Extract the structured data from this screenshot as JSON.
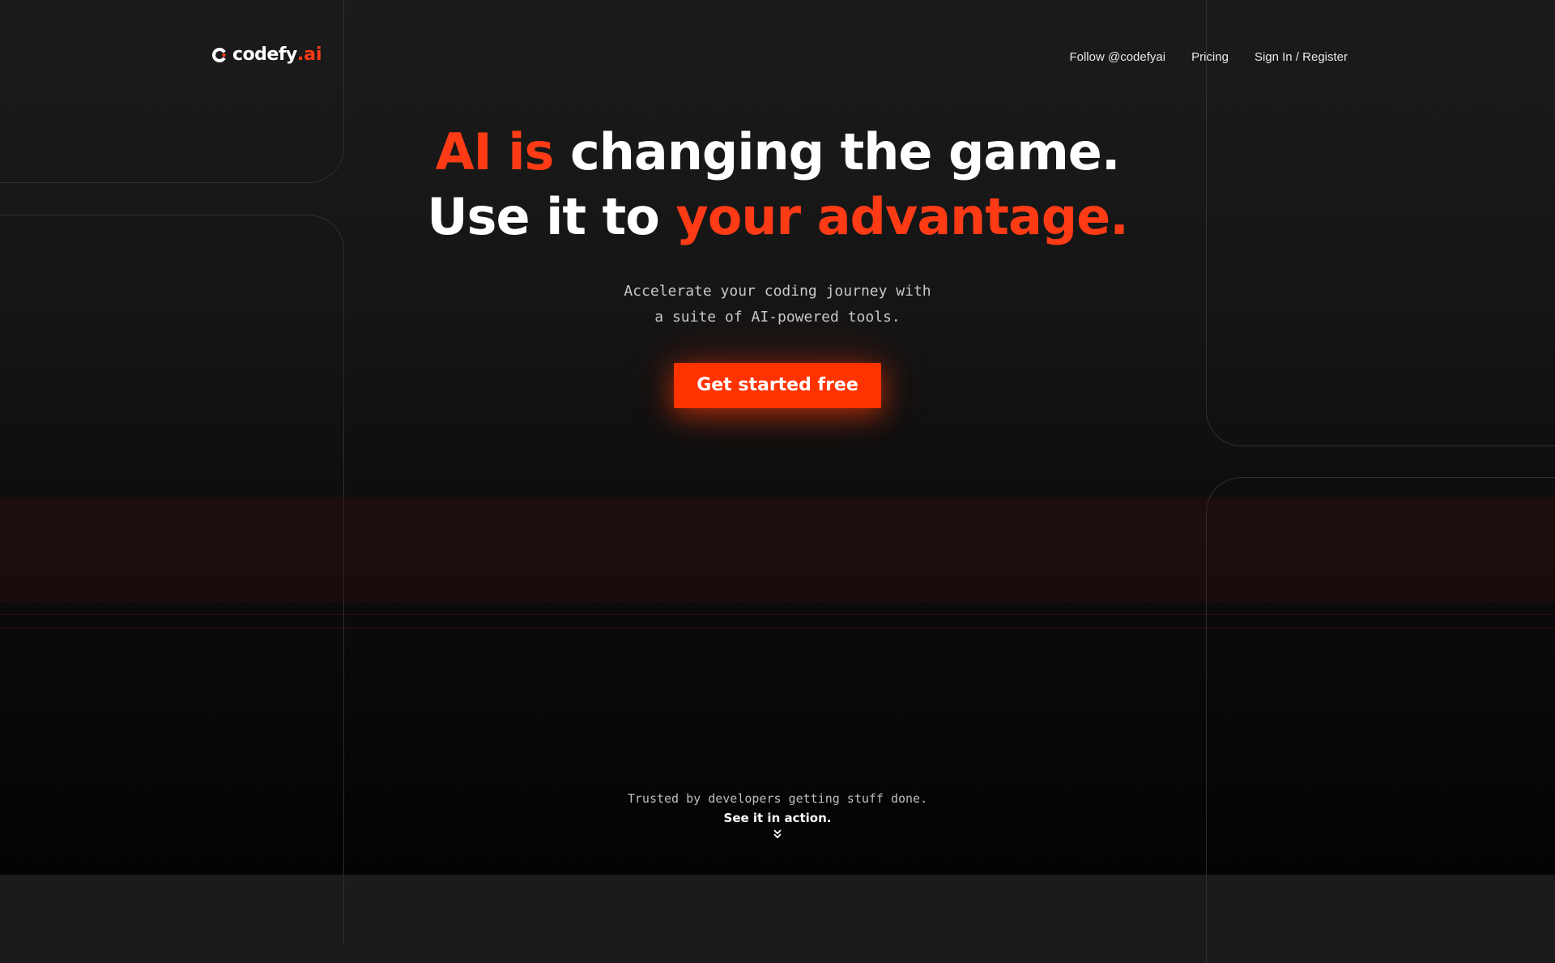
{
  "brand": {
    "name": "codefy",
    "tld": ".ai",
    "logo_icon": "c-arc-logo-icon",
    "accent_color": "#ff3b16"
  },
  "nav": {
    "items": [
      {
        "label": "Follow @codefyai"
      },
      {
        "label": "Pricing"
      },
      {
        "label": "Sign In / Register"
      }
    ]
  },
  "hero": {
    "line1": {
      "accent": "AI is",
      "rest": " changing the game."
    },
    "line2": {
      "rest": "Use it to ",
      "accent": "your advantage."
    },
    "subtitle_line1": "Accelerate your coding journey with",
    "subtitle_line2": "a suite of AI-powered tools.",
    "cta_label": "Get started free",
    "cta_color": "#ff3300"
  },
  "footer_cta": {
    "trusted": "Trusted by developers getting stuff done.",
    "see_action": "See it in action.",
    "scroll_icon": "double-chevron-down-icon"
  }
}
